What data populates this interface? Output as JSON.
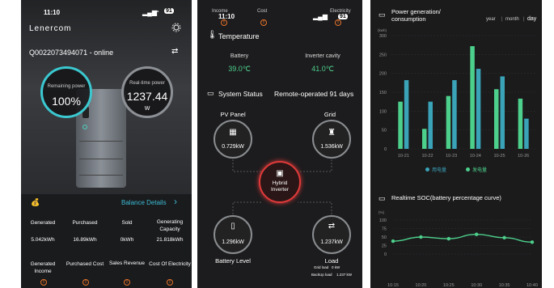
{
  "s1": {
    "time": "11:10",
    "battery": "91",
    "logo": "Lenercom",
    "device": "Q0022073494071 - online",
    "remaining_label": "Remaining power",
    "remaining_value": "100%",
    "realtime_label": "Real-time power",
    "realtime_value": "1237.44",
    "realtime_unit": "W",
    "balance_label": "Balance Details",
    "stats": [
      {
        "label": "Generated",
        "value": "5.042kWh"
      },
      {
        "label": "Purchased",
        "value": "16.89kWh"
      },
      {
        "label": "Sold",
        "value": "0kWh"
      },
      {
        "label": "Generating Capacity",
        "value": "21.818kWh"
      }
    ],
    "bottom": [
      {
        "label": "Generated Income"
      },
      {
        "label": "Purchased Cost"
      },
      {
        "label": "Sales Revenue"
      },
      {
        "label": "Cost Of Electricity"
      }
    ]
  },
  "s2": {
    "time": "11:10",
    "battery": "91",
    "top_labels": [
      "Income",
      "Cost",
      "Electricity"
    ],
    "temperature_title": "Temperature",
    "battery_label": "Battery",
    "battery_temp": "39.0℃",
    "cavity_label": "Inverter cavity",
    "cavity_temp": "41.0℃",
    "status_title": "System Status",
    "status_info": "Remote-operated 91 days",
    "pv_label": "PV Panel",
    "pv_value": "0.729kW",
    "grid_label": "Grid",
    "grid_value": "1.536kW",
    "inverter_label": "Hybrid Inverter",
    "battery_value": "1.296kW",
    "battery_level_label": "Battery Level",
    "load_value": "1.237kW",
    "load_label": "Load",
    "grid_load": "Grid load",
    "grid_load_value": "0 kW",
    "backup_load": "BackUp load",
    "backup_load_value": "1.237 kW"
  },
  "s3": {
    "title": "Power generation/ consumption",
    "range_tabs": [
      "year",
      "month",
      "day"
    ],
    "unit": "(kwh)",
    "legend": [
      "用电量",
      "发电量"
    ],
    "soc_title": "Realtime SOC(battery percentage curve)",
    "soc_unit": "(%)",
    "colors": {
      "use": "#3aa3b8",
      "gen": "#4dd08b",
      "soc": "#4dd08b"
    }
  },
  "chart_data": [
    {
      "type": "bar",
      "title": "Power generation/ consumption",
      "ylabel": "(kwh)",
      "categories": [
        "10-21",
        "10-22",
        "10-23",
        "10-24",
        "10-25",
        "10-26"
      ],
      "ylim": [
        0,
        300
      ],
      "yticks": [
        0,
        50,
        100,
        150,
        200,
        250,
        300
      ],
      "series": [
        {
          "name": "用电量",
          "values": [
            125,
            53,
            140,
            272,
            158,
            133
          ]
        },
        {
          "name": "发电量",
          "values": [
            182,
            125,
            182,
            212,
            192,
            80
          ]
        }
      ]
    },
    {
      "type": "line",
      "title": "Realtime SOC(battery percentage curve)",
      "ylabel": "(%)",
      "x": [
        "10:15",
        "10:20",
        "10:25",
        "10:30",
        "10:35",
        "10:40"
      ],
      "ylim": [
        0,
        100
      ],
      "yticks": [
        0,
        25,
        50,
        75,
        100
      ],
      "series": [
        {
          "values": [
            38,
            50,
            45,
            58,
            48,
            35
          ]
        }
      ]
    }
  ]
}
